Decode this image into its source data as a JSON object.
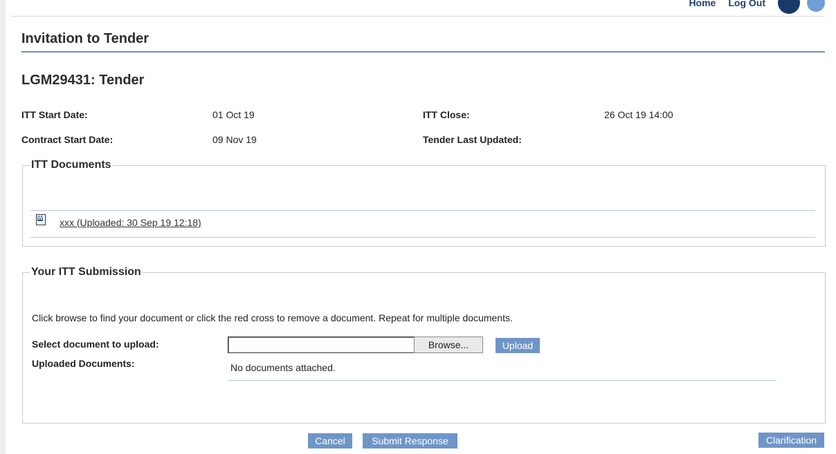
{
  "top_nav": {
    "home": "Home",
    "logout": "Log Out"
  },
  "page": {
    "title": "Invitation to Tender",
    "tender_ref": "LGM29431: Tender"
  },
  "tender_info": {
    "itt_start_label": "ITT Start Date:",
    "itt_start_value": "01 Oct 19",
    "itt_close_label": "ITT Close:",
    "itt_close_value": "26 Oct 19 14:00",
    "contract_start_label": "Contract Start Date:",
    "contract_start_value": "09 Nov 19",
    "last_updated_label": "Tender Last Updated:",
    "last_updated_value": ""
  },
  "itt_documents": {
    "legend": "ITT Documents",
    "items": [
      {
        "icon": "word-document-icon",
        "label": "xxx (Uploaded: 30 Sep 19 12:18)"
      }
    ]
  },
  "submission": {
    "legend": "Your ITT Submission",
    "instructions": "Click browse to find your document or click the red cross to remove a document. Repeat for multiple documents.",
    "select_label": "Select document to upload:",
    "file_value": "",
    "browse_label": "Browse...",
    "upload_label": "Upload",
    "uploaded_label": "Uploaded Documents:",
    "uploaded_empty": "No documents attached."
  },
  "actions": {
    "cancel": "Cancel",
    "submit": "Submit Response",
    "clarification": "Clarification"
  },
  "colors": {
    "accent_button": "#6f95c8",
    "title_rule": "#6f8fb8",
    "nav_dark": "#173a6b"
  }
}
